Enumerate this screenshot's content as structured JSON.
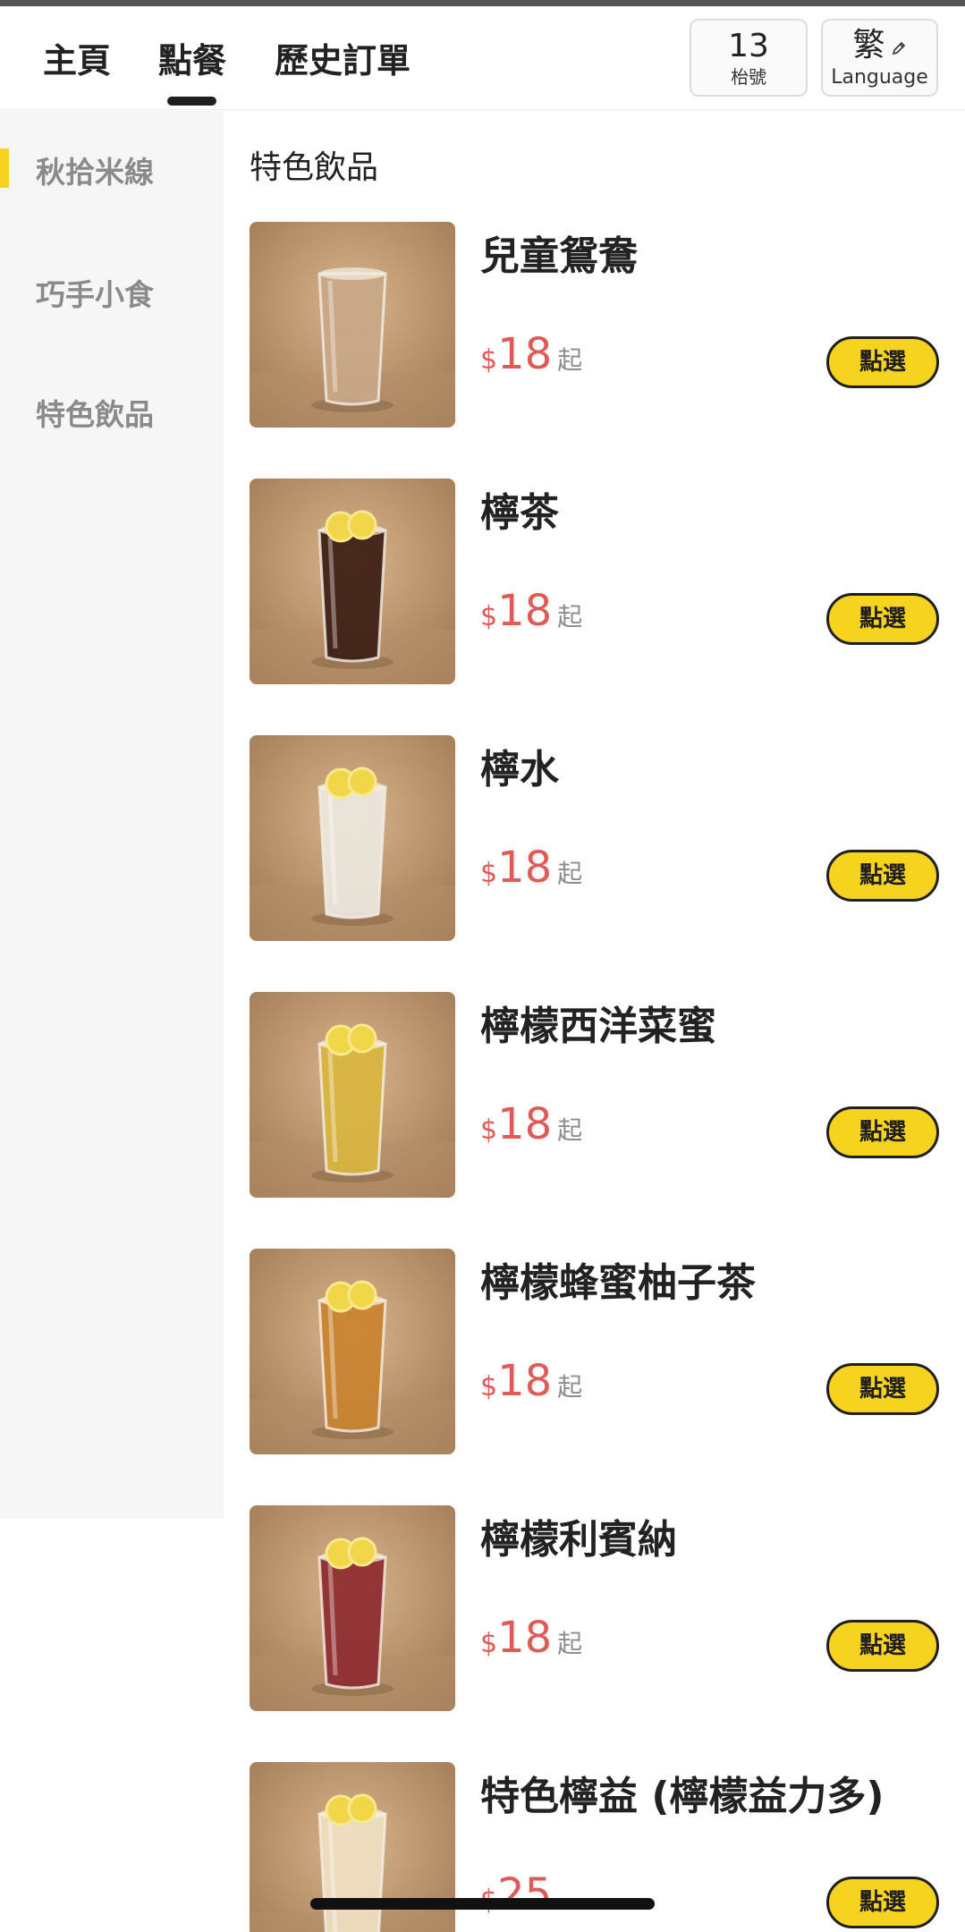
{
  "header": {
    "tabs": [
      {
        "label": "主頁",
        "active": false
      },
      {
        "label": "點餐",
        "active": true
      },
      {
        "label": "歷史訂單",
        "active": false
      }
    ],
    "table_number": "13",
    "table_label": "枱號",
    "language_current": "繁",
    "language_label": "Language",
    "language_icon": "pencil-icon"
  },
  "sidebar": {
    "items": [
      {
        "label": "秋拾米線",
        "active": true
      },
      {
        "label": "巧手小食",
        "active": false
      },
      {
        "label": "特色飲品",
        "active": false
      }
    ],
    "accent_color": "#f6d31f"
  },
  "section": {
    "title": "特色飲品"
  },
  "menu": {
    "items": [
      {
        "name": "兒童鴛鴦",
        "currency": "$",
        "price": "18",
        "suffix": "起",
        "button": "點選",
        "drink_color": "#c9a888"
      },
      {
        "name": "檸茶",
        "currency": "$",
        "price": "18",
        "suffix": "起",
        "button": "點選",
        "drink_color": "#3b1d14"
      },
      {
        "name": "檸水",
        "currency": "$",
        "price": "18",
        "suffix": "起",
        "button": "點選",
        "drink_color": "#ece8df"
      },
      {
        "name": "檸檬西洋菜蜜",
        "currency": "$",
        "price": "18",
        "suffix": "起",
        "button": "點選",
        "drink_color": "#d9b540"
      },
      {
        "name": "檸檬蜂蜜柚子茶",
        "currency": "$",
        "price": "18",
        "suffix": "起",
        "button": "點選",
        "drink_color": "#c88330"
      },
      {
        "name": "檸檬利賓納",
        "currency": "$",
        "price": "18",
        "suffix": "起",
        "button": "點選",
        "drink_color": "#8e2a30"
      },
      {
        "name": "特色檸益 (檸檬益力多)",
        "currency": "$",
        "price": "25",
        "suffix": "",
        "button": "點選",
        "drink_color": "#efe0c2"
      }
    ]
  },
  "colors": {
    "price": "#e05b58",
    "button": "#f6d31f",
    "sidebar_bg": "#f6f6f6"
  }
}
